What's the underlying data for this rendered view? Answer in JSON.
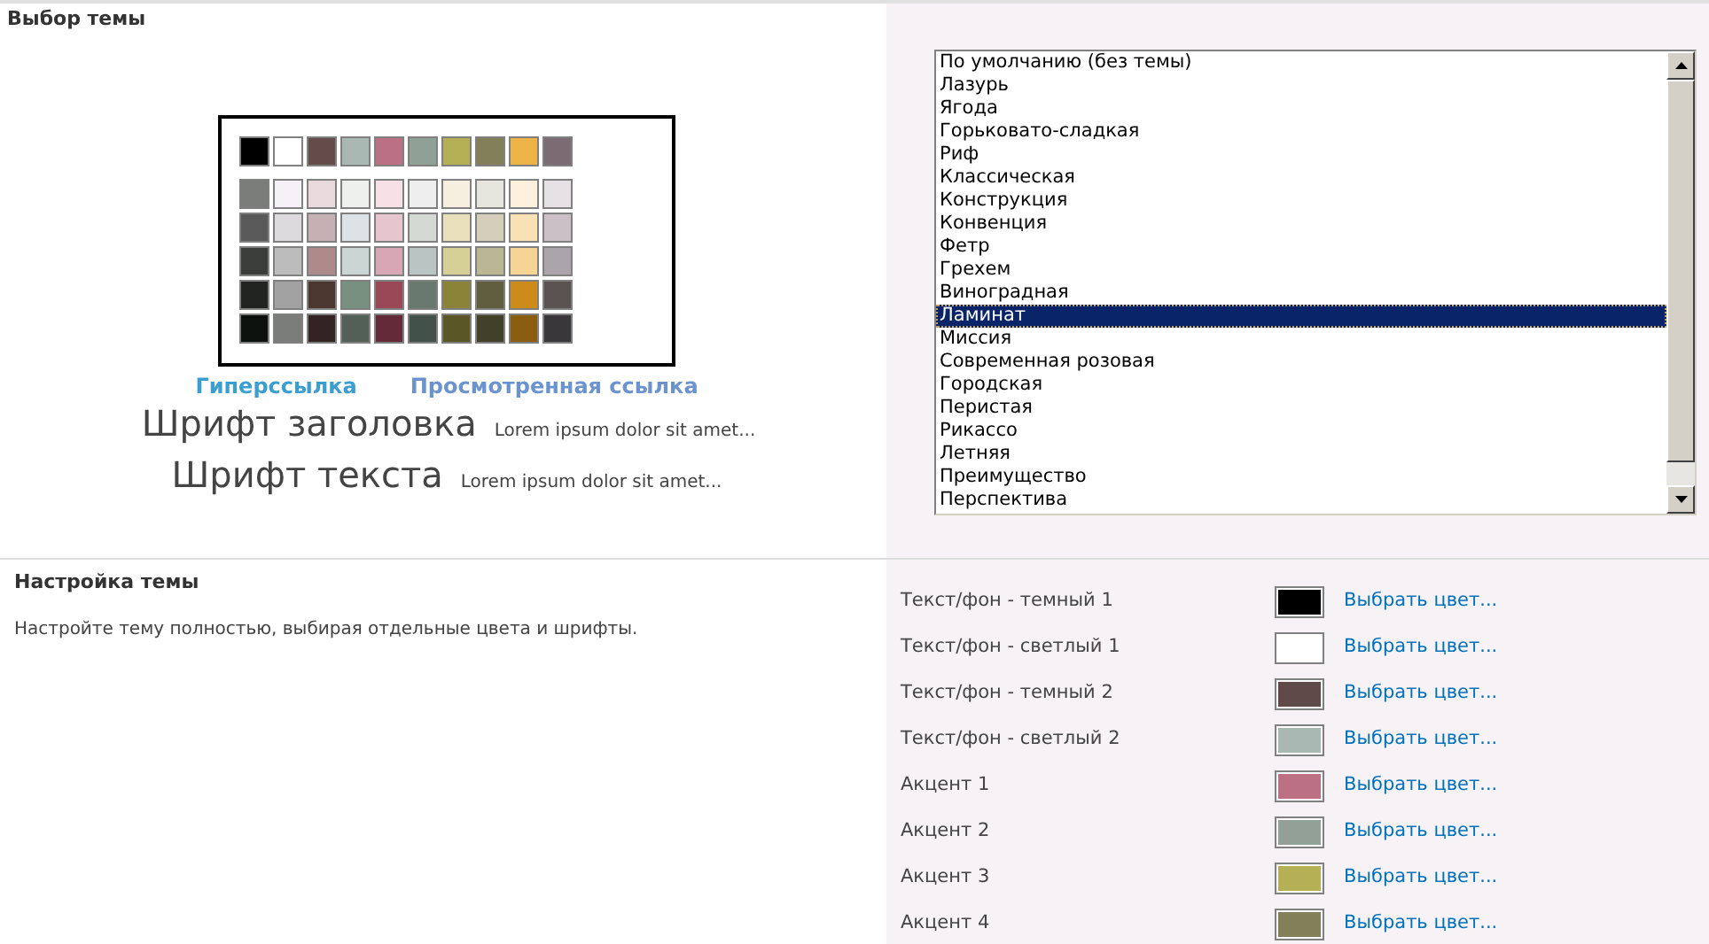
{
  "theme_section": {
    "title": "Выбор темы"
  },
  "preview": {
    "top_colors": [
      {
        "color": "#000000"
      },
      {
        "color": "#ffffff"
      },
      {
        "color": "#634c4a"
      },
      {
        "color": "#aab8b3"
      },
      {
        "color": "#bc7083"
      },
      {
        "color": "#8fa097"
      },
      {
        "color": "#b5b055"
      },
      {
        "color": "#827f59"
      },
      {
        "color": "#efb448"
      },
      {
        "color": "#7b6c73"
      }
    ],
    "shade_rows": [
      [
        {
          "color": "#7b7d7a"
        },
        {
          "color": "#f6f1f6"
        },
        {
          "color": "#e7d9dc"
        },
        {
          "color": "#edf0ed"
        },
        {
          "color": "#f7e0e6"
        },
        {
          "color": "#eeeeee"
        },
        {
          "color": "#f6eedf"
        },
        {
          "color": "#e6e6de"
        },
        {
          "color": "#fdf1de"
        },
        {
          "color": "#e5e1e4"
        }
      ],
      [
        {
          "color": "#5a5a5a"
        },
        {
          "color": "#dcdadd"
        },
        {
          "color": "#c6b0b4"
        },
        {
          "color": "#dde2e6"
        },
        {
          "color": "#e6c5ce"
        },
        {
          "color": "#d5d9d4"
        },
        {
          "color": "#e8dfbb"
        },
        {
          "color": "#d5cebb"
        },
        {
          "color": "#f7e1b5"
        },
        {
          "color": "#cbc0c5"
        }
      ],
      [
        {
          "color": "#3b3d3b"
        },
        {
          "color": "#bcbcbc"
        },
        {
          "color": "#ae8b8b"
        },
        {
          "color": "#cbd5d4"
        },
        {
          "color": "#d8a7b5"
        },
        {
          "color": "#bac4c2"
        },
        {
          "color": "#d7d096"
        },
        {
          "color": "#bbb694"
        },
        {
          "color": "#f6d495"
        },
        {
          "color": "#aba4aa"
        }
      ],
      [
        {
          "color": "#222422"
        },
        {
          "color": "#a2a2a2"
        },
        {
          "color": "#4b3630"
        },
        {
          "color": "#77907f"
        },
        {
          "color": "#9a4758"
        },
        {
          "color": "#68786f"
        },
        {
          "color": "#8b8338"
        },
        {
          "color": "#605e3f"
        },
        {
          "color": "#cd8b1a"
        },
        {
          "color": "#5b5252"
        }
      ],
      [
        {
          "color": "#0d110d"
        },
        {
          "color": "#7b7d7a"
        },
        {
          "color": "#332423"
        },
        {
          "color": "#536058"
        },
        {
          "color": "#632b39"
        },
        {
          "color": "#42524a"
        },
        {
          "color": "#5a5626"
        },
        {
          "color": "#414029"
        },
        {
          "color": "#8b5d10"
        },
        {
          "color": "#3a373b"
        }
      ]
    ],
    "hyperlink": "Гиперссылка",
    "visited_link": "Просмотренная ссылка",
    "heading_font": "Шрифт заголовка",
    "heading_sample": "Lorem ipsum dolor sit amet...",
    "body_font": "Шрифт текста",
    "body_sample": "Lorem ipsum dolor sit amet..."
  },
  "theme_list": [
    {
      "label": "По умолчанию (без темы)",
      "selected": false
    },
    {
      "label": "Лазурь",
      "selected": false
    },
    {
      "label": "Ягода",
      "selected": false
    },
    {
      "label": "Горьковато-сладкая",
      "selected": false
    },
    {
      "label": "Риф",
      "selected": false
    },
    {
      "label": "Классическая",
      "selected": false
    },
    {
      "label": "Конструкция",
      "selected": false
    },
    {
      "label": "Конвенция",
      "selected": false
    },
    {
      "label": "Фетр",
      "selected": false
    },
    {
      "label": "Грехем",
      "selected": false
    },
    {
      "label": "Виноградная",
      "selected": false
    },
    {
      "label": "Ламинат",
      "selected": true
    },
    {
      "label": "Миссия",
      "selected": false
    },
    {
      "label": "Современная розовая",
      "selected": false
    },
    {
      "label": "Городская",
      "selected": false
    },
    {
      "label": "Перистая",
      "selected": false
    },
    {
      "label": "Рикассо",
      "selected": false
    },
    {
      "label": "Летняя",
      "selected": false
    },
    {
      "label": "Преимущество",
      "selected": false
    },
    {
      "label": "Перспектива",
      "selected": false
    }
  ],
  "customize": {
    "title": "Настройка темы",
    "description": "Настройте тему полностью, выбирая отдельные цвета и шрифты."
  },
  "color_settings": [
    {
      "label": "Текст/фон - темный 1",
      "color": "#000000",
      "link": "Выбрать цвет..."
    },
    {
      "label": "Текст/фон - светлый 1",
      "color": "#ffffff",
      "link": "Выбрать цвет..."
    },
    {
      "label": "Текст/фон - темный 2",
      "color": "#5f4a49",
      "link": "Выбрать цвет..."
    },
    {
      "label": "Текст/фон - светлый 2",
      "color": "#aab8b3",
      "link": "Выбрать цвет..."
    },
    {
      "label": "Акцент 1",
      "color": "#bc7083",
      "link": "Выбрать цвет..."
    },
    {
      "label": "Акцент 2",
      "color": "#92a098",
      "link": "Выбрать цвет..."
    },
    {
      "label": "Акцент 3",
      "color": "#b5af55",
      "link": "Выбрать цвет..."
    },
    {
      "label": "Акцент 4",
      "color": "#827f59",
      "link": "Выбрать цвет..."
    }
  ]
}
